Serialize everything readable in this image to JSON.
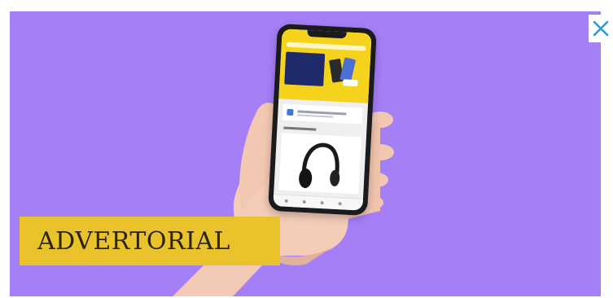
{
  "ad": {
    "label": "ADVERTORIAL",
    "close_icon": "close-icon",
    "background_color": "#a47ff6",
    "label_color": "#e9c22c",
    "close_color": "#2a9bd6"
  }
}
